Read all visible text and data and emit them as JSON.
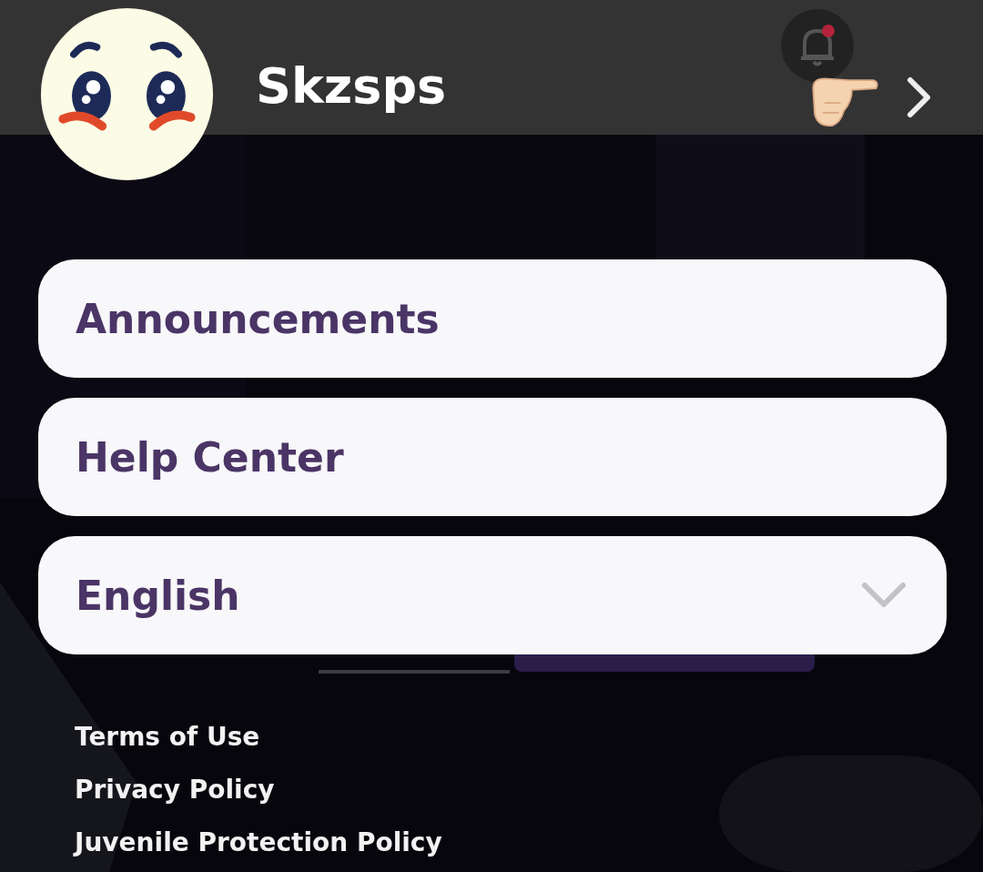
{
  "header": {
    "username": "Skzsps"
  },
  "menu": [
    {
      "kind": "link",
      "label": "Announcements"
    },
    {
      "kind": "link",
      "label": "Help Center"
    },
    {
      "kind": "dropdown",
      "label": "English"
    }
  ],
  "footer_links": [
    "Terms of Use",
    "Privacy Policy",
    "Juvenile Protection Policy"
  ]
}
